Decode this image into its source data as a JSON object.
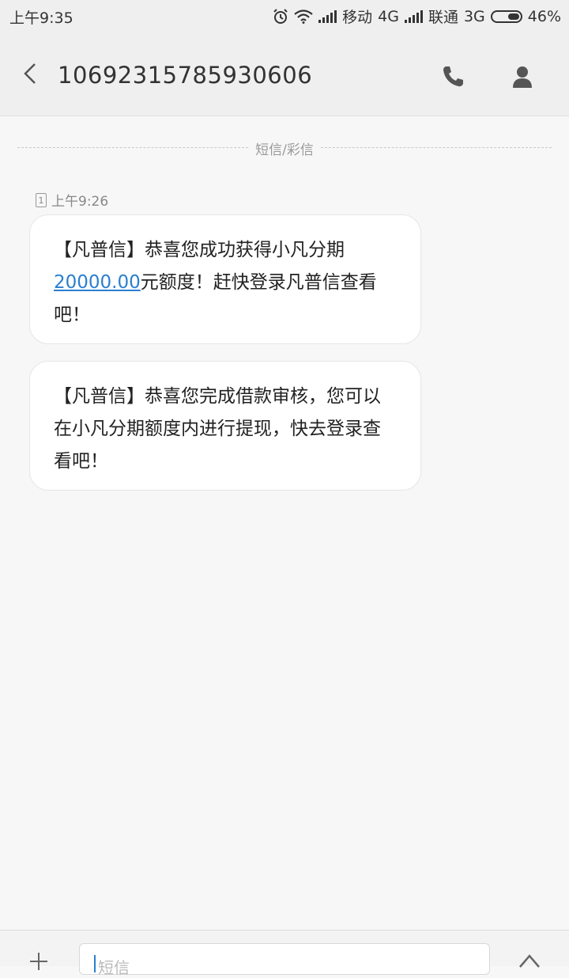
{
  "status_bar": {
    "time": "上午9:35",
    "carrier1": "移动",
    "network1": "4G",
    "carrier2": "联通",
    "network2": "3G",
    "battery": "46%"
  },
  "header": {
    "title": "10692315785930606"
  },
  "divider": {
    "label": "短信/彩信"
  },
  "message_meta": {
    "sim": "1",
    "time": "上午9:26"
  },
  "messages": [
    {
      "part1": "【凡普信】恭喜您成功获得小凡分期",
      "amount": "20000.00",
      "part2": "元额度！赶快登录凡普信查看吧！"
    },
    {
      "text": "【凡普信】恭喜您完成借款审核，您可以在小凡分期额度内进行提现，快去登录查看吧！"
    }
  ],
  "composer": {
    "placeholder": "短信"
  },
  "colors": {
    "link": "#2a7fd0",
    "background": "#f7f7f7"
  }
}
